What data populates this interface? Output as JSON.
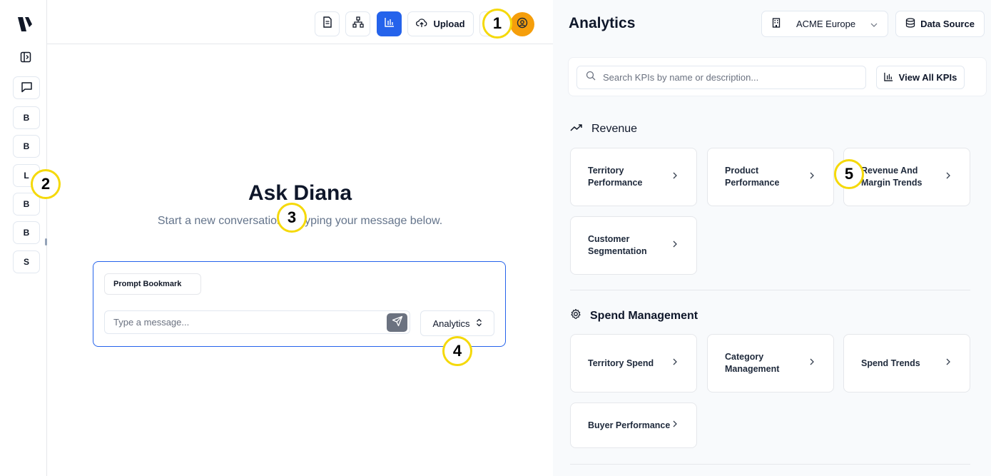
{
  "rail": {
    "items": [
      {
        "label": "B"
      },
      {
        "label": "B"
      },
      {
        "label": "L"
      },
      {
        "label": "B"
      },
      {
        "label": "B"
      },
      {
        "label": "S"
      }
    ]
  },
  "toolbar": {
    "upload_label": "Upload"
  },
  "chat": {
    "title": "Ask Diana",
    "subtitle": "Start a new conversation by typing your message below.",
    "bookmark_chip": "Prompt Bookmark",
    "input_placeholder": "Type a message...",
    "mode_value": "Analytics"
  },
  "panel": {
    "title": "Analytics",
    "org_value": "ACME Europe",
    "data_source_label": "Data Source",
    "search_placeholder": "Search KPIs by name or description...",
    "view_all_label": "View All KPIs",
    "sections": [
      {
        "title": "Revenue",
        "icon": "trending-up-icon",
        "cards": [
          "Territory Performance",
          "Product Performance",
          "Revenue And Margin Trends",
          "Customer Segmentation"
        ]
      },
      {
        "title": "Spend Management",
        "icon": "settings-icon",
        "cards": [
          "Territory Spend",
          "Category Management",
          "Spend Trends",
          "Buyer Performance"
        ]
      }
    ]
  },
  "markers": [
    "1",
    "2",
    "3",
    "4",
    "5"
  ],
  "colors": {
    "accent": "#2563eb",
    "avatar": "#f59e0b",
    "marker_ring": "#f5d90a"
  }
}
